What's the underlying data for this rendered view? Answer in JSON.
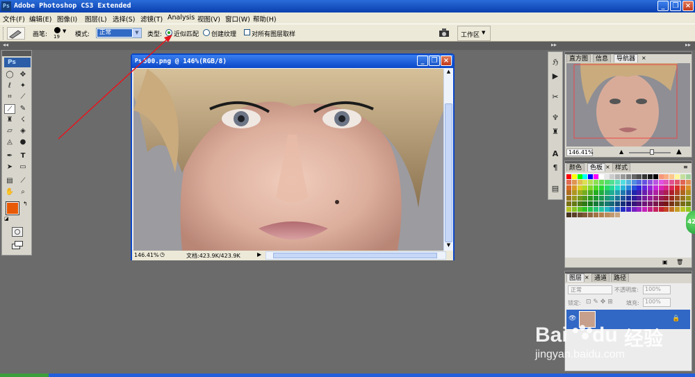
{
  "app": {
    "title": "Adobe Photoshop CS3 Extended",
    "logo": "Ps",
    "window_buttons": {
      "minimize": "_",
      "restore": "❐",
      "close": "×"
    }
  },
  "menu": [
    "文件(F)",
    "编辑(E)",
    "图像(I)",
    "图层(L)",
    "选择(S)",
    "滤镜(T)",
    "Analysis",
    "视图(V)",
    "窗口(W)",
    "帮助(H)"
  ],
  "options": {
    "brush_label": "画笔:",
    "brush_size": "19",
    "mode_label": "模式:",
    "mode_value": "正常",
    "type_label": "类型:",
    "radio_proximity": "近似匹配",
    "radio_texture": "创建纹理",
    "checkbox_all_layers": "对所有图层取样",
    "workspace": "工作区"
  },
  "tools": {
    "logo": "Ps",
    "foreground_color": "#e85a05",
    "background_color": "#000000"
  },
  "document": {
    "title": "500.png @ 146%(RGB/8)",
    "zoom": "146.41%",
    "doc_info": "文档:423.9K/423.9K"
  },
  "navigator": {
    "tabs": [
      "直方图",
      "信息",
      "导航器"
    ],
    "zoom": "146.41%"
  },
  "color_panel": {
    "tabs": [
      "颜色",
      "色板",
      "样式"
    ]
  },
  "layers_panel": {
    "tabs": [
      "图层",
      "通道",
      "路径"
    ],
    "blend_mode": "正常",
    "opacity_label": "不透明度:",
    "opacity_value": "100%",
    "lock_label": "锁定:",
    "fill_label": "填充:",
    "fill_value": "100%"
  },
  "badge": "42",
  "watermark": {
    "brand_a": "Bai",
    "brand_b": "du",
    "brand_cn": "经验",
    "url": "jingyan.baidu.com"
  },
  "colors": {
    "accent": "#0a47c7",
    "annotation_arrow": "#e8141c"
  }
}
